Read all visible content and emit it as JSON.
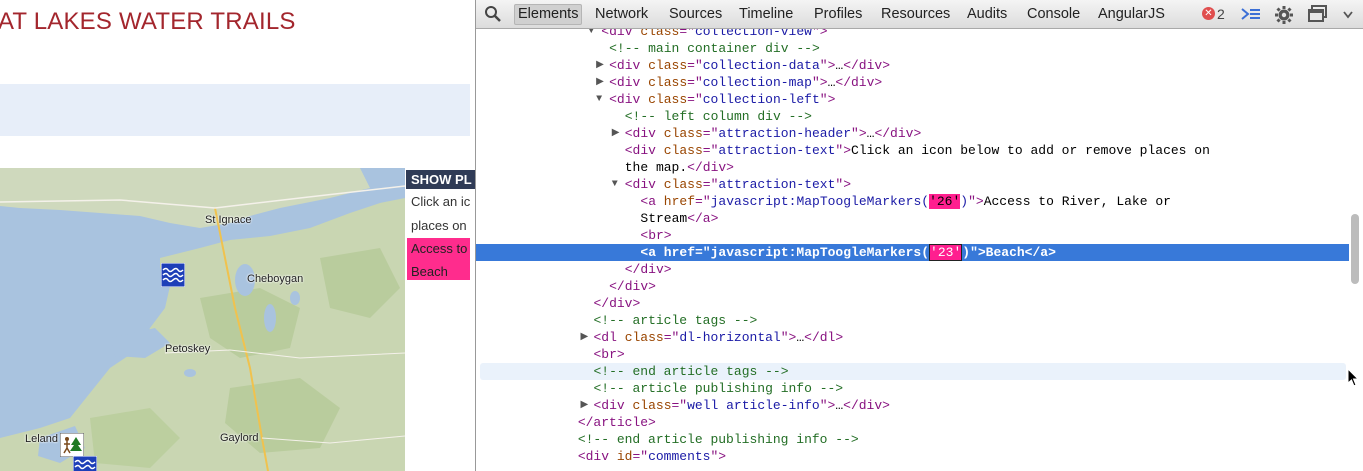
{
  "website": {
    "title": "AT LAKES WATER TRAILS",
    "side_panel": {
      "header": "SHOW PL",
      "lines": [
        "Click an ic",
        "places on"
      ],
      "highlight_lines": [
        "Access to",
        "Beach"
      ]
    },
    "map_labels": [
      "St Ignace",
      "Cheboygan",
      "Petoskey",
      "Leland",
      "Gaylord"
    ]
  },
  "devtools": {
    "tabs": [
      "Elements",
      "Network",
      "Sources",
      "Timeline",
      "Profiles",
      "Resources",
      "Audits",
      "Console",
      "AngularJS"
    ],
    "active_tab": "Elements",
    "error_count": "2",
    "icons": [
      "search-icon",
      "error-icon",
      "console-drawer-icon",
      "settings-gear-icon",
      "dock-icon"
    ]
  },
  "dom_tree": [
    {
      "indent": 15,
      "tri": "open",
      "segs": [
        [
          "tag",
          "<div "
        ],
        [
          "an",
          "class"
        ],
        [
          "tag",
          "=\""
        ],
        [
          "av",
          "collection-view"
        ],
        [
          "tag",
          "\">"
        ]
      ]
    },
    {
      "indent": 16,
      "tri": "",
      "segs": [
        [
          "cm",
          "<!-- main container div -->"
        ]
      ]
    },
    {
      "indent": 16,
      "tri": "closed",
      "segs": [
        [
          "tag",
          "<div "
        ],
        [
          "an",
          "class"
        ],
        [
          "tag",
          "=\""
        ],
        [
          "av",
          "collection-data"
        ],
        [
          "tag",
          "\">"
        ],
        [
          "tx",
          "…"
        ],
        [
          "tag",
          "</div>"
        ]
      ]
    },
    {
      "indent": 16,
      "tri": "closed",
      "segs": [
        [
          "tag",
          "<div "
        ],
        [
          "an",
          "class"
        ],
        [
          "tag",
          "=\""
        ],
        [
          "av",
          "collection-map"
        ],
        [
          "tag",
          "\">"
        ],
        [
          "tx",
          "…"
        ],
        [
          "tag",
          "</div>"
        ]
      ]
    },
    {
      "indent": 16,
      "tri": "open",
      "segs": [
        [
          "tag",
          "<div "
        ],
        [
          "an",
          "class"
        ],
        [
          "tag",
          "=\""
        ],
        [
          "av",
          "collection-left"
        ],
        [
          "tag",
          "\">"
        ]
      ]
    },
    {
      "indent": 18,
      "tri": "",
      "segs": [
        [
          "cm",
          "<!-- left column div -->"
        ]
      ]
    },
    {
      "indent": 18,
      "tri": "closed",
      "segs": [
        [
          "tag",
          "<div "
        ],
        [
          "an",
          "class"
        ],
        [
          "tag",
          "=\""
        ],
        [
          "av",
          "attraction-header"
        ],
        [
          "tag",
          "\">"
        ],
        [
          "tx",
          "…"
        ],
        [
          "tag",
          "</div>"
        ]
      ]
    },
    {
      "indent": 18,
      "tri": "",
      "segs": [
        [
          "tag",
          "<div "
        ],
        [
          "an",
          "class"
        ],
        [
          "tag",
          "=\""
        ],
        [
          "av",
          "attraction-text"
        ],
        [
          "tag",
          "\">"
        ],
        [
          "tx",
          "Click an icon below to add or remove places on"
        ]
      ]
    },
    {
      "indent": 18,
      "tri": "",
      "segs": [
        [
          "tx",
          "the map."
        ],
        [
          "tag",
          "</div>"
        ]
      ]
    },
    {
      "indent": 18,
      "tri": "open",
      "segs": [
        [
          "tag",
          "<div "
        ],
        [
          "an",
          "class"
        ],
        [
          "tag",
          "=\""
        ],
        [
          "av",
          "attraction-text"
        ],
        [
          "tag",
          "\">"
        ]
      ]
    },
    {
      "indent": 20,
      "tri": "",
      "segs": [
        [
          "tag",
          "<a "
        ],
        [
          "an",
          "href"
        ],
        [
          "tag",
          "=\""
        ],
        [
          "av",
          "javascript:MapToogleMarkers("
        ],
        [
          "hl",
          "'26'"
        ],
        [
          "av",
          ")"
        ],
        [
          "tag",
          "\">"
        ],
        [
          "tx",
          "Access to River, Lake or"
        ]
      ]
    },
    {
      "indent": 20,
      "tri": "",
      "segs": [
        [
          "tx",
          "Stream"
        ],
        [
          "tag",
          "</a>"
        ]
      ]
    },
    {
      "indent": 20,
      "tri": "",
      "segs": [
        [
          "tag",
          "<br>"
        ]
      ]
    },
    {
      "indent": 20,
      "tri": "",
      "selected": true,
      "segs": [
        [
          "sel",
          "<a href=\"javascript:MapToogleMarkers("
        ],
        [
          "selhl",
          "'23'"
        ],
        [
          "sel",
          ")\">Beach</a>"
        ]
      ]
    },
    {
      "indent": 18,
      "tri": "",
      "segs": [
        [
          "tag",
          "</div>"
        ]
      ]
    },
    {
      "indent": 16,
      "tri": "",
      "segs": [
        [
          "tag",
          "</div>"
        ]
      ]
    },
    {
      "indent": 14,
      "tri": "",
      "segs": [
        [
          "tag",
          "</div>"
        ]
      ]
    },
    {
      "indent": 14,
      "tri": "",
      "segs": [
        [
          "cm",
          "<!--  article tags  -->"
        ]
      ]
    },
    {
      "indent": 14,
      "tri": "closed",
      "segs": [
        [
          "tag",
          "<dl "
        ],
        [
          "an",
          "class"
        ],
        [
          "tag",
          "=\""
        ],
        [
          "av",
          "dl-horizontal"
        ],
        [
          "tag",
          "\">"
        ],
        [
          "tx",
          "…"
        ],
        [
          "tag",
          "</dl>"
        ]
      ]
    },
    {
      "indent": 14,
      "tri": "",
      "segs": [
        [
          "tag",
          "<br>"
        ]
      ]
    },
    {
      "indent": 14,
      "tri": "",
      "hover": true,
      "segs": [
        [
          "cm",
          "<!--  end article tags  -->"
        ]
      ]
    },
    {
      "indent": 14,
      "tri": "",
      "segs": [
        [
          "cm",
          "<!--  article publishing info  -->"
        ]
      ]
    },
    {
      "indent": 14,
      "tri": "closed",
      "segs": [
        [
          "tag",
          "<div "
        ],
        [
          "an",
          "class"
        ],
        [
          "tag",
          "=\""
        ],
        [
          "av",
          "well article-info"
        ],
        [
          "tag",
          "\">"
        ],
        [
          "tx",
          "…"
        ],
        [
          "tag",
          "</div>"
        ]
      ]
    },
    {
      "indent": 12,
      "tri": "",
      "segs": [
        [
          "tag",
          "</article>"
        ]
      ]
    },
    {
      "indent": 12,
      "tri": "",
      "segs": [
        [
          "cm",
          "<!--  end article publishing info  -->"
        ]
      ]
    },
    {
      "indent": 12,
      "tri": "",
      "segs": [
        [
          "tag",
          "<div "
        ],
        [
          "an",
          "id"
        ],
        [
          "tag",
          "=\""
        ],
        [
          "av",
          "comments"
        ],
        [
          "tag",
          "\">"
        ]
      ]
    }
  ],
  "colors": {
    "title_red": "#a3262d",
    "selection_blue": "#3879d9",
    "highlight_pink": "#ff1f8f",
    "tag_purple": "#881280",
    "attr_name": "#994500",
    "attr_value": "#1a1aa6",
    "comment_green": "#236e25"
  }
}
